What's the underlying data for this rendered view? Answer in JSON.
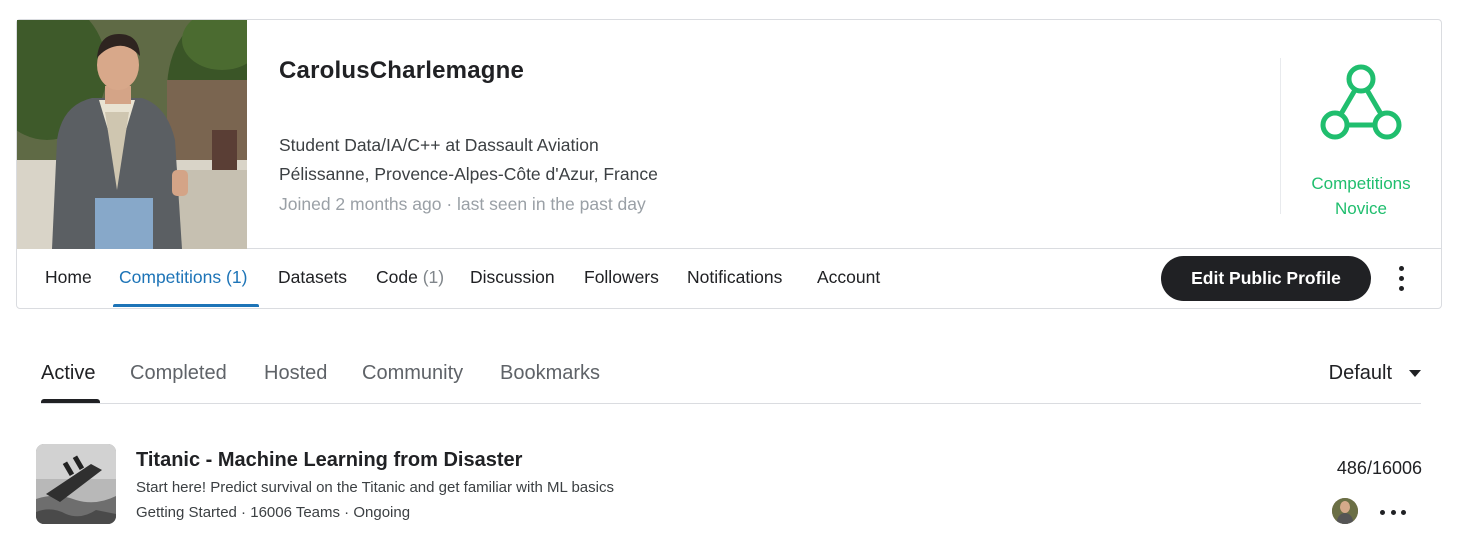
{
  "profile": {
    "username": "CarolusCharlemagne",
    "occupation": "Student Data/IA/C++ at Dassault Aviation",
    "location": "Pélissanne, Provence-Alpes-Côte d'Azur, France",
    "joined": "Joined 2 months ago · last seen in the past day",
    "tier_line1": "Competitions",
    "tier_line2": "Novice",
    "tier_color": "#20be6e"
  },
  "nav": {
    "home": "Home",
    "competitions": "Competitions",
    "competitions_count": "(1)",
    "datasets": "Datasets",
    "code": "Code",
    "code_count": "(1)",
    "discussion": "Discussion",
    "followers": "Followers",
    "notifications": "Notifications",
    "account": "Account",
    "edit_profile": "Edit Public Profile",
    "active_tab": "Competitions"
  },
  "subtabs": {
    "items": [
      "Active",
      "Completed",
      "Hosted",
      "Community",
      "Bookmarks"
    ],
    "active": "Active",
    "sort_label": "Default"
  },
  "competition": {
    "title": "Titanic - Machine Learning from Disaster",
    "description": "Start here! Predict survival on the Titanic and get familiar with ML basics",
    "meta": "Getting Started · 16006 Teams · Ongoing",
    "rank": "486/16006"
  },
  "colors": {
    "accent": "#1d74b7",
    "button_bg": "#202124",
    "tier": "#20be6e"
  }
}
